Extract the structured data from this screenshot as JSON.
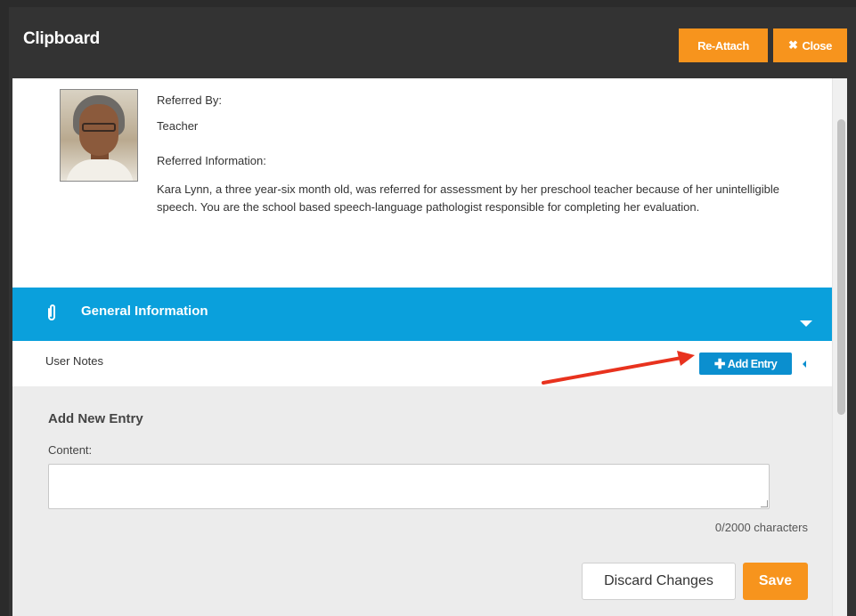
{
  "window": {
    "title": "Clipboard",
    "reattach_label": "Re-Attach",
    "close_label": "Close"
  },
  "referral": {
    "referred_by_label": "Referred By:",
    "referred_by_value": "Teacher",
    "info_label": "Referred Information:",
    "info_text": "Kara Lynn, a three year-six month old, was referred for assessment by her preschool teacher because of her unintelligible speech. You are the school based speech-language pathologist responsible for completing her evaluation."
  },
  "section": {
    "title": "General Information",
    "icon": "paperclip-icon"
  },
  "notes": {
    "label": "User Notes",
    "add_entry_label": "Add Entry"
  },
  "entry_form": {
    "title": "Add New Entry",
    "content_label": "Content:",
    "content_value": "",
    "char_count": "0/2000 characters",
    "discard_label": "Discard Changes",
    "save_label": "Save"
  },
  "colors": {
    "accent_orange": "#f7941d",
    "section_blue": "#0aa0dc",
    "button_blue": "#0b8fcf",
    "annotation_red": "#e8321e"
  }
}
